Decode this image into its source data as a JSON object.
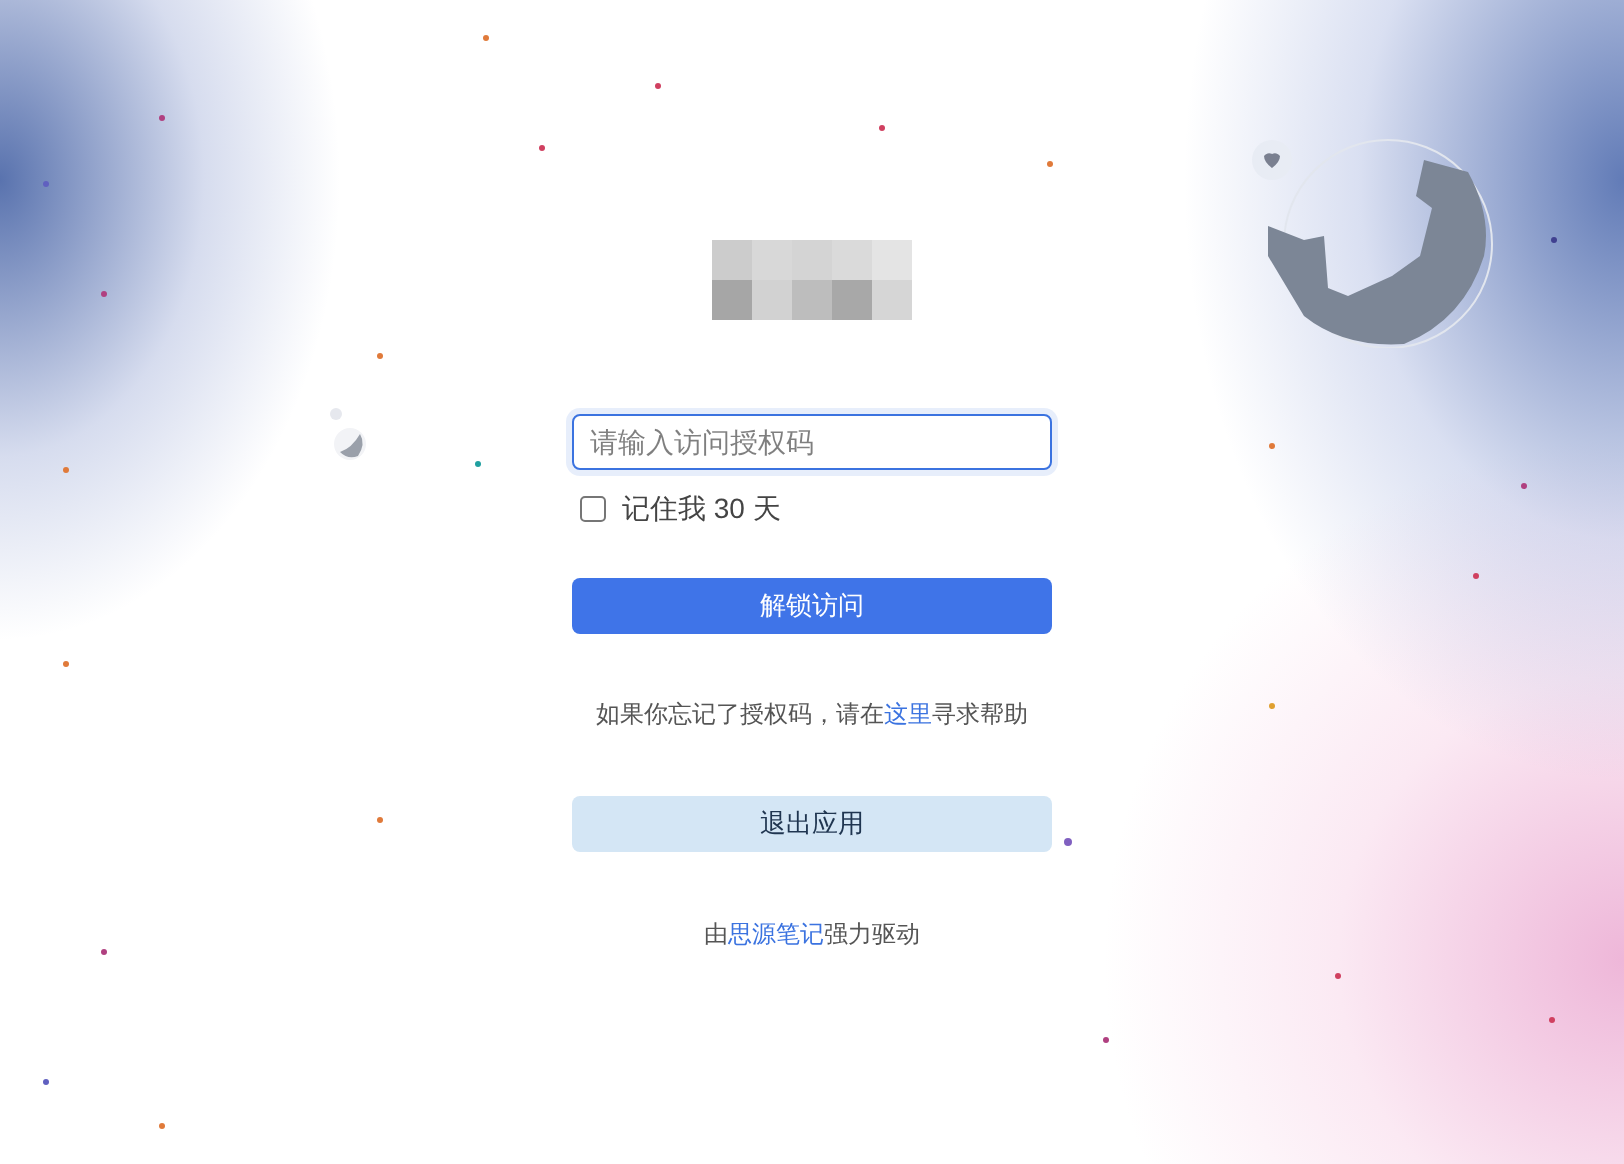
{
  "login": {
    "password_field": {
      "placeholder": "请输入访问授权码"
    },
    "remember": {
      "label": "记住我 30 天",
      "checked": false
    },
    "unlock_button": "解锁访问",
    "help": {
      "before": "如果你忘记了授权码，请在",
      "link": "这里",
      "after": "寻求帮助"
    },
    "exit_button": "退出应用",
    "footer": {
      "before": "由",
      "link": "思源笔记",
      "after": "强力驱动"
    }
  }
}
